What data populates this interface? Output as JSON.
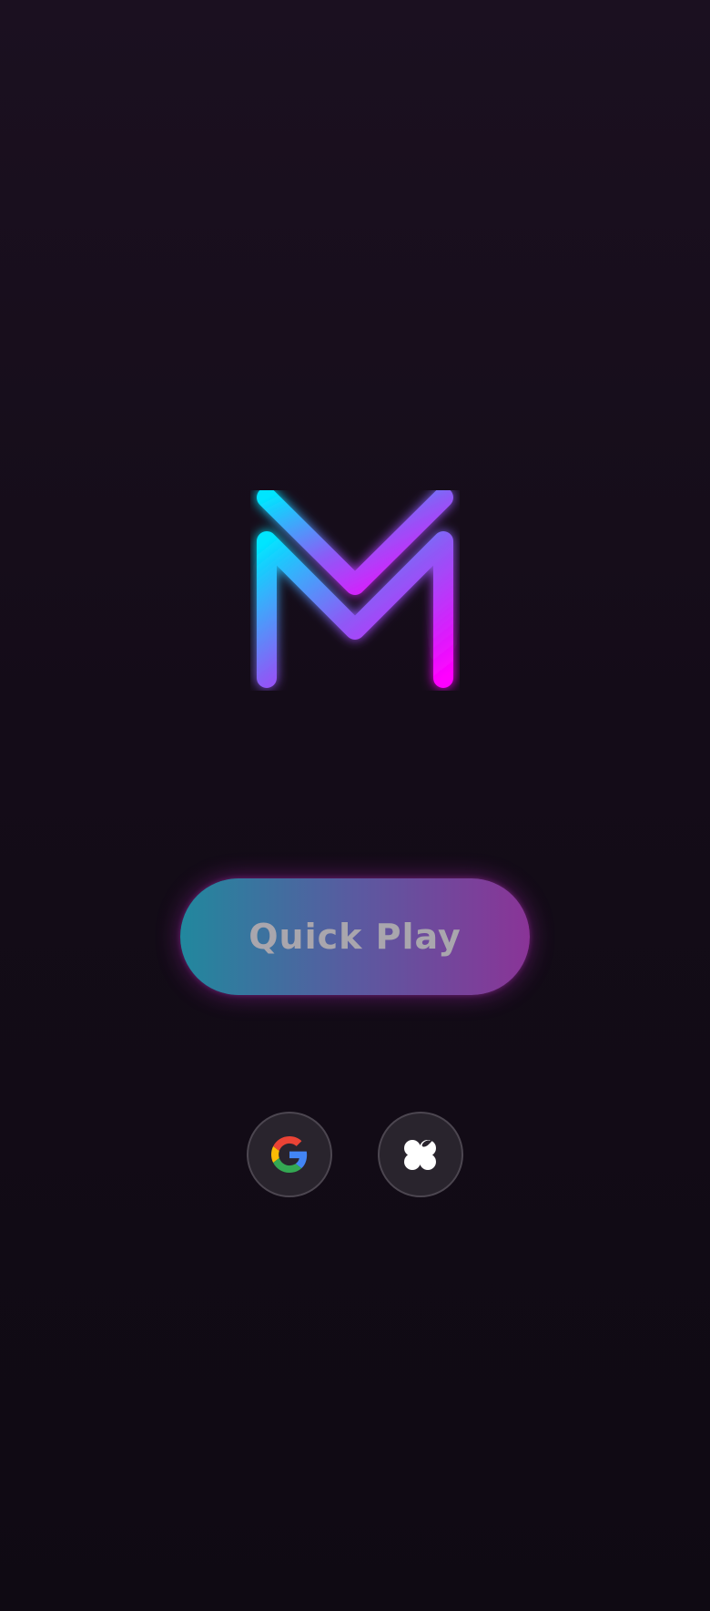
{
  "app": {
    "logo_icon": "neon-m-logo-icon"
  },
  "actions": {
    "quick_play_label": "Quick Play"
  },
  "social_login": [
    {
      "provider": "google",
      "icon": "google-icon"
    },
    {
      "provider": "apple",
      "icon": "apple-icon"
    }
  ],
  "colors": {
    "background_top": "#1b1020",
    "background_bottom": "#0f0a13",
    "logo_cyan": "#00e5ff",
    "logo_magenta": "#ff00ff",
    "button_start": "#21889e",
    "button_end": "#8a3497",
    "button_text": "#a9a6ad",
    "social_bg": "#29242d"
  }
}
